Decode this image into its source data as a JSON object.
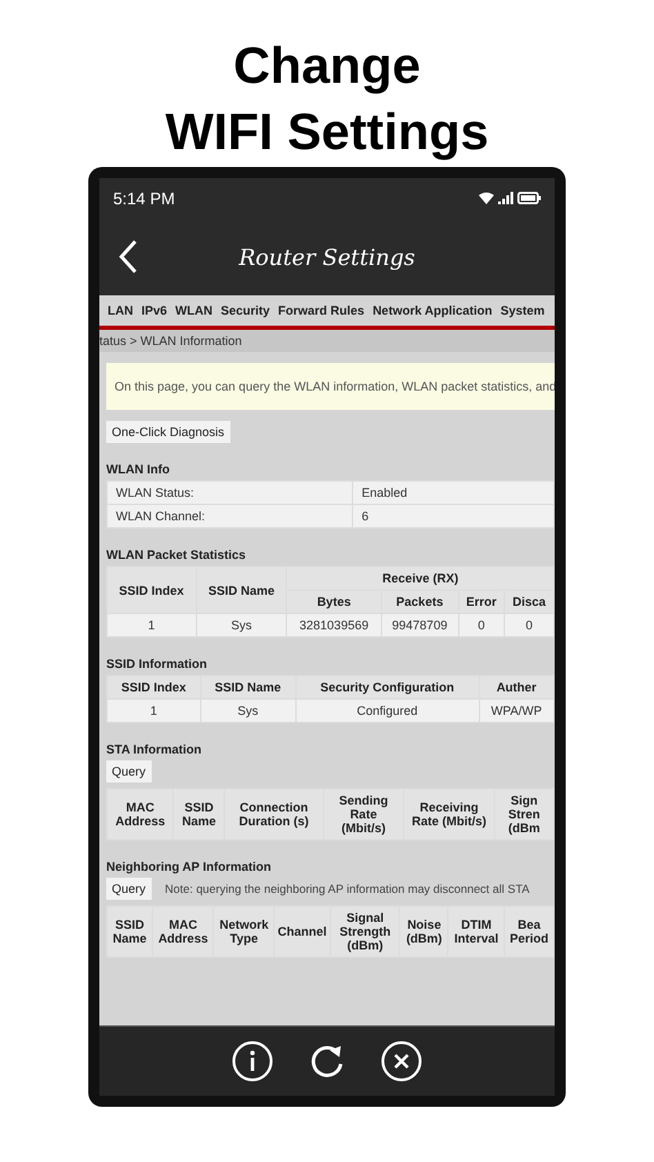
{
  "headline": [
    "Change",
    "WIFI Settings"
  ],
  "status_bar": {
    "time": "5:14 PM"
  },
  "app_bar": {
    "title": "Router Settings"
  },
  "tabs": [
    {
      "label": "LAN",
      "selected": false
    },
    {
      "label": "IPv6",
      "selected": false
    },
    {
      "label": "WLAN",
      "selected": false
    },
    {
      "label": "Security",
      "selected": false
    },
    {
      "label": "Forward Rules",
      "selected": false
    },
    {
      "label": "Network Application",
      "selected": false
    },
    {
      "label": "System",
      "selected": false
    }
  ],
  "breadcrumb": "tatus > WLAN Information",
  "notice": "On this page, you can query the WLAN information, WLAN packet statistics, and",
  "diagnosis_button": "One-Click Diagnosis",
  "sections": [
    {
      "title": "WLAN Info",
      "kind": "kv",
      "rows": [
        [
          "WLAN Status:",
          "Enabled"
        ],
        [
          "WLAN Channel:",
          "6"
        ]
      ]
    },
    {
      "title": "WLAN Packet Statistics",
      "kind": "table",
      "header_rows": [
        [
          {
            "text": "SSID Index",
            "rowspan": 2
          },
          {
            "text": "SSID Name",
            "rowspan": 2
          },
          {
            "text": "Receive (RX)",
            "colspan": 4
          }
        ],
        [
          {
            "text": "Bytes"
          },
          {
            "text": "Packets"
          },
          {
            "text": "Error"
          },
          {
            "text": "Disca"
          }
        ]
      ],
      "rows": [
        [
          "1",
          "Sys",
          "3281039569",
          "99478709",
          "0",
          "0"
        ]
      ]
    },
    {
      "title": "SSID Information",
      "kind": "table",
      "header_rows": [
        [
          {
            "text": "SSID Index"
          },
          {
            "text": "SSID Name"
          },
          {
            "text": "Security Configuration"
          },
          {
            "text": "Auther"
          }
        ]
      ],
      "rows": [
        [
          "1",
          "Sys",
          "Configured",
          "WPA/WP"
        ]
      ]
    },
    {
      "title": "STA Information",
      "kind": "table",
      "query_button": "Query",
      "header_rows": [
        [
          {
            "text": "MAC Address"
          },
          {
            "text": "SSID Name"
          },
          {
            "text": "Connection Duration (s)"
          },
          {
            "text": "Sending Rate (Mbit/s)"
          },
          {
            "text": "Receiving Rate (Mbit/s)"
          },
          {
            "text": "Sign Stren (dBm"
          }
        ]
      ]
    },
    {
      "title": "Neighboring AP Information",
      "kind": "table",
      "query_button": "Query",
      "note": "Note: querying the neighboring AP information may disconnect all STA",
      "header_rows": [
        [
          {
            "text": "SSID Name"
          },
          {
            "text": "MAC Address"
          },
          {
            "text": "Network Type"
          },
          {
            "text": "Channel"
          },
          {
            "text": "Signal Strength (dBm)"
          },
          {
            "text": "Noise (dBm)"
          },
          {
            "text": "DTIM Interval"
          },
          {
            "text": "Bea Period"
          }
        ]
      ]
    }
  ]
}
